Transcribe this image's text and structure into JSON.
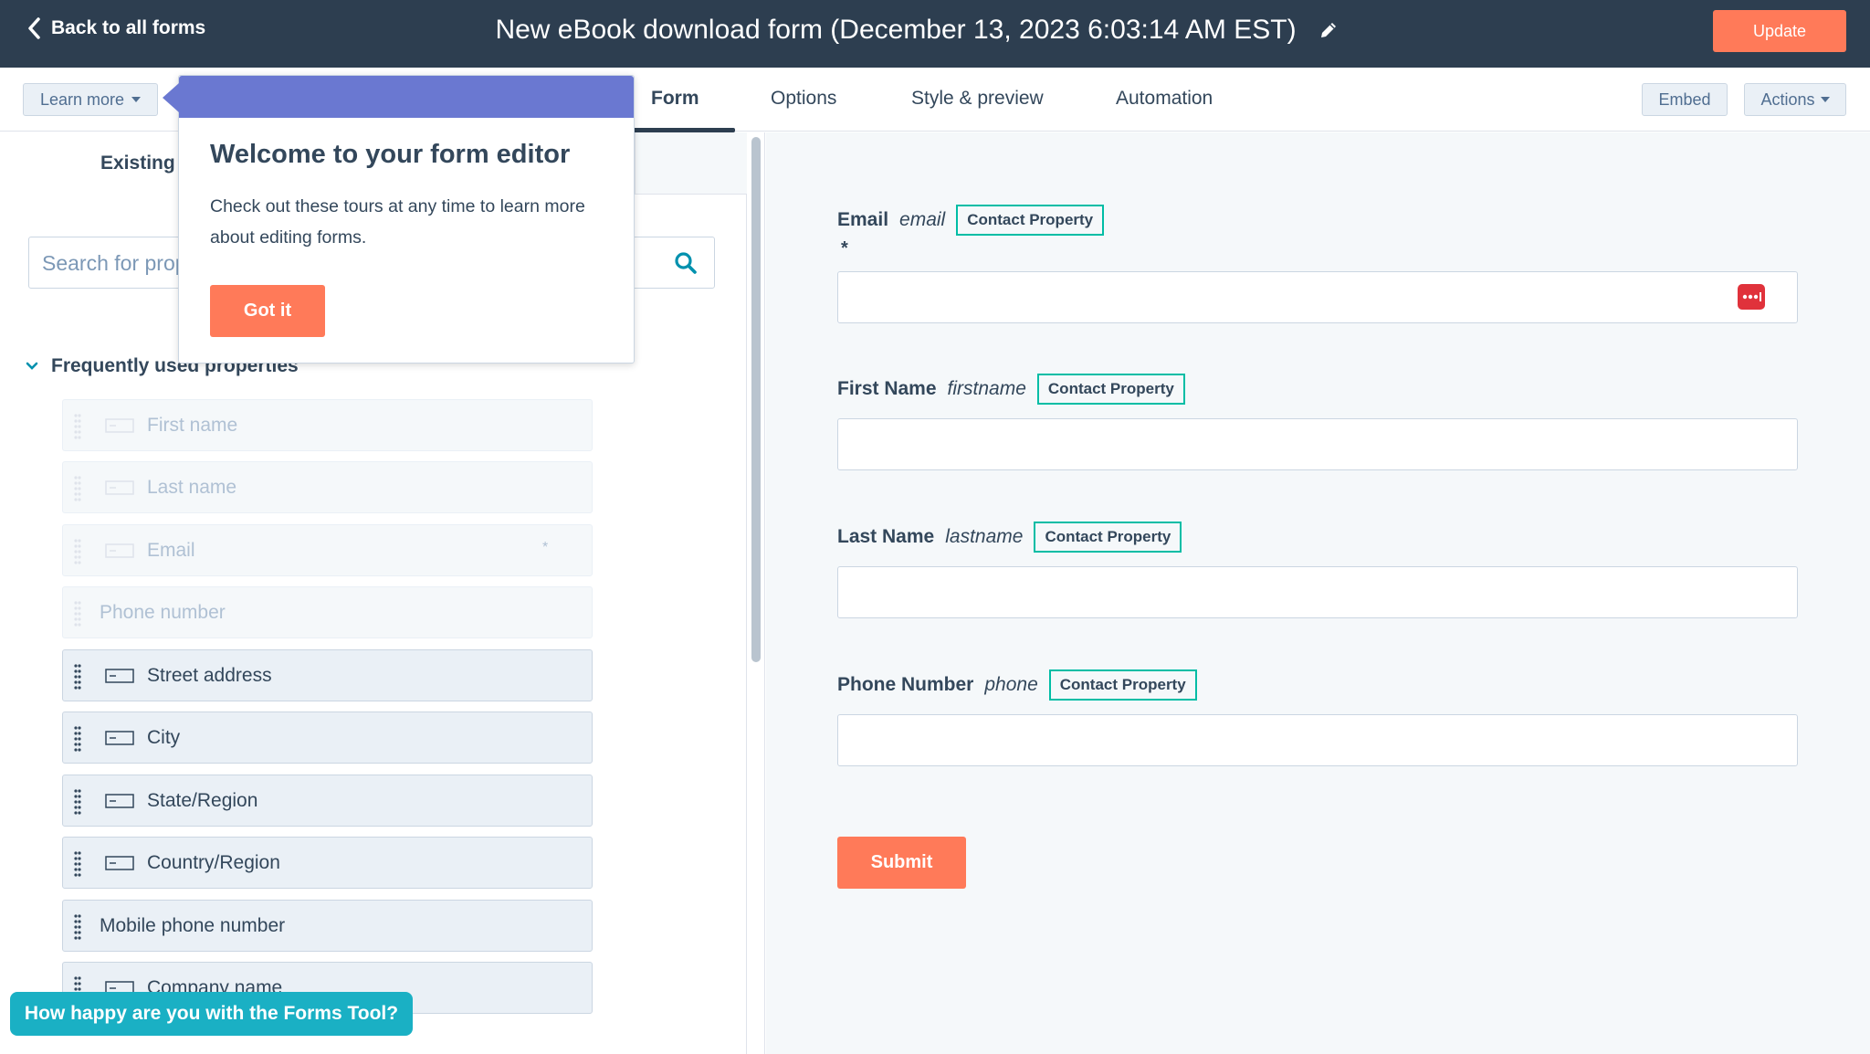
{
  "header": {
    "back_label": "Back to all forms",
    "title": "New eBook download form (December 13, 2023 6:03:14 AM EST)",
    "update_label": "Update"
  },
  "tabbar": {
    "learn_more_label": "Learn more",
    "tabs": [
      {
        "label": "Form",
        "active": true
      },
      {
        "label": "Options",
        "active": false
      },
      {
        "label": "Style & preview",
        "active": false
      },
      {
        "label": "Automation",
        "active": false
      }
    ],
    "embed_label": "Embed",
    "actions_label": "Actions"
  },
  "left_panel": {
    "existing_tab_label": "Existing",
    "search_placeholder": "Search for properties",
    "section_label": "Frequently used properties",
    "properties": [
      {
        "label": "First name",
        "state": "disabled",
        "icon": "text-field-icon"
      },
      {
        "label": "Last name",
        "state": "disabled",
        "icon": "text-field-icon"
      },
      {
        "label": "Email",
        "state": "disabled",
        "icon": "text-field-icon",
        "required": "*"
      },
      {
        "label": "Phone number",
        "state": "disabled",
        "icon": null
      },
      {
        "label": "Street address",
        "state": "enabled",
        "icon": "text-field-icon"
      },
      {
        "label": "City",
        "state": "enabled",
        "icon": "text-field-icon"
      },
      {
        "label": "State/Region",
        "state": "enabled",
        "icon": "text-field-icon"
      },
      {
        "label": "Country/Region",
        "state": "enabled",
        "icon": "text-field-icon"
      },
      {
        "label": "Mobile phone number",
        "state": "enabled",
        "icon": null
      },
      {
        "label": "Company name",
        "state": "enabled",
        "icon": "text-field-icon"
      }
    ]
  },
  "popover": {
    "title": "Welcome to your form editor",
    "body": "Check out these tours at any time to learn more about editing forms.",
    "button_label": "Got it"
  },
  "feedback": {
    "label": "How happy are you with the Forms Tool?"
  },
  "preview": {
    "fields": [
      {
        "label": "Email",
        "internal_name": "email",
        "badge": "Contact Property",
        "required": "*"
      },
      {
        "label": "First Name",
        "internal_name": "firstname",
        "badge": "Contact Property"
      },
      {
        "label": "Last Name",
        "internal_name": "lastname",
        "badge": "Contact Property"
      },
      {
        "label": "Phone Number",
        "internal_name": "phone",
        "badge": "Contact Property"
      }
    ],
    "submit_label": "Submit"
  },
  "colors": {
    "header_bg": "#2d3e50",
    "accent_orange": "#ff7a59",
    "popover_header": "#6a78d1",
    "badge_border": "#00bda5",
    "feedback_bg": "#1ab0c4"
  }
}
